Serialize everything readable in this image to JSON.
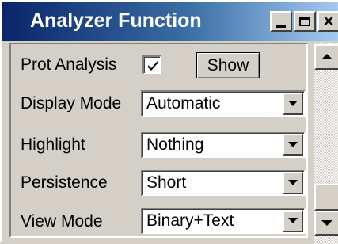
{
  "window": {
    "title": "Analyzer Function"
  },
  "caption_buttons": {
    "minimize": "minimize-icon",
    "maximize": "maximize-icon",
    "close": "close-icon"
  },
  "rows": {
    "prot_analysis": {
      "label": "Prot Analysis",
      "checked": true,
      "button_label": "Show"
    },
    "display_mode": {
      "label": "Display Mode",
      "value": "Automatic"
    },
    "highlight": {
      "label": "Highlight",
      "value": "Nothing"
    },
    "persistence": {
      "label": "Persistence",
      "value": "Short"
    },
    "view_mode": {
      "label": "View Mode",
      "value": "Binary+Text"
    }
  },
  "colors": {
    "titlebar_start": "#0a246a",
    "titlebar_end": "#a6caf0",
    "face": "#d4d0c8"
  }
}
